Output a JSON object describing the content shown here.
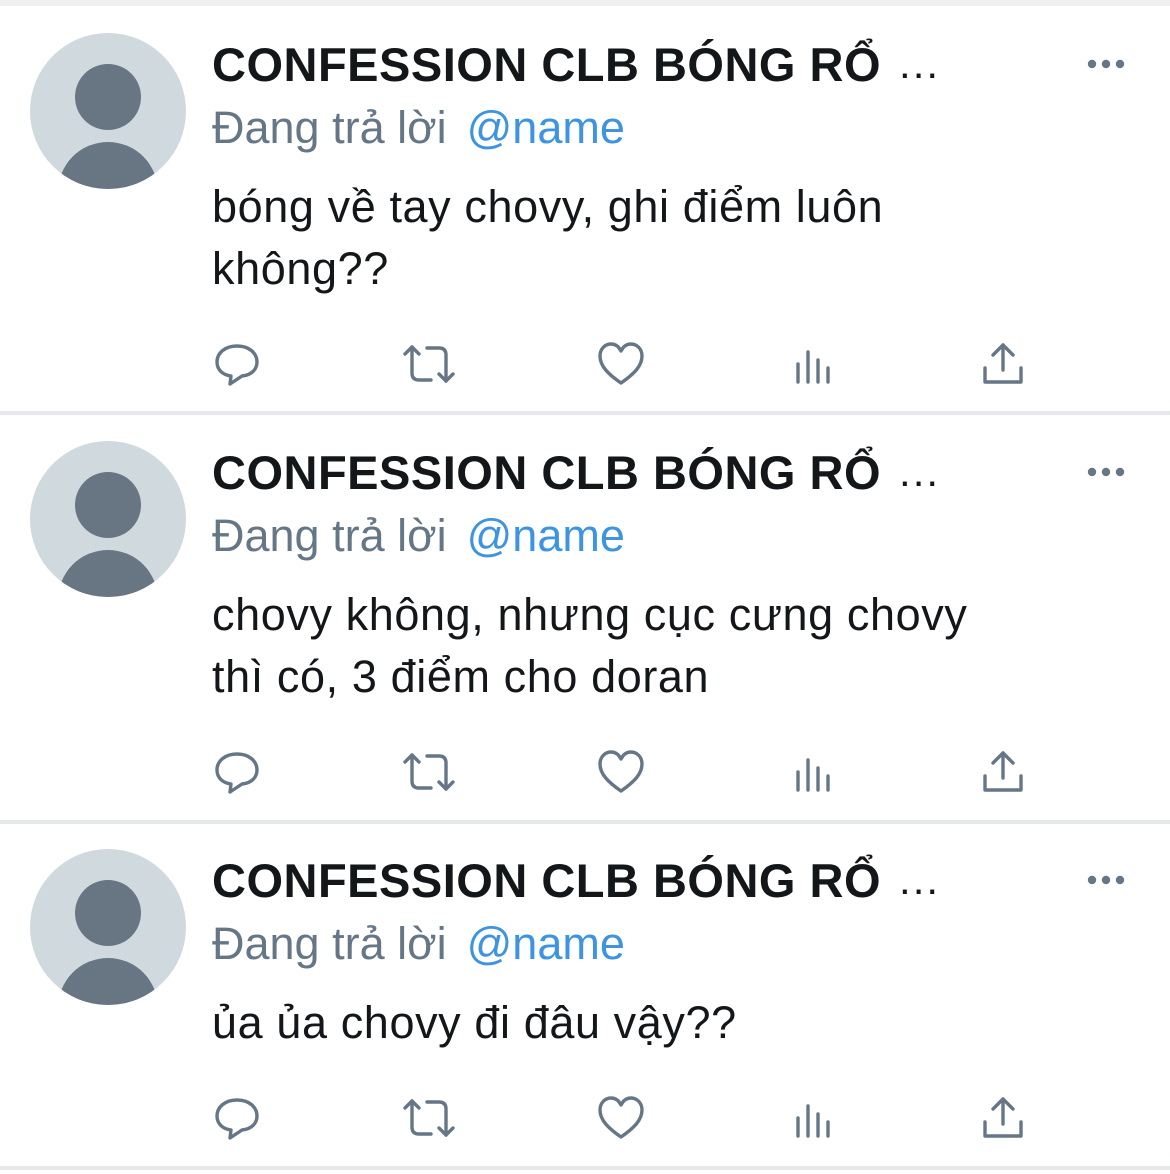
{
  "colors": {
    "name": "#14171a",
    "secondary": "#657786",
    "link": "#3d94e0",
    "icon": "#657786",
    "avatar_bg": "#cfd9de",
    "avatar_fg": "#687684",
    "divider": "#e6e9ec"
  },
  "icons": {
    "more": "more-horizontal-icon",
    "reply": "reply-icon",
    "retweet": "retweet-icon",
    "like": "heart-icon",
    "analytics": "analytics-icon",
    "share": "share-icon",
    "avatar": "default-avatar-icon"
  },
  "tweets": [
    {
      "display_name": "CONFESSION CLB BÓNG RỔ",
      "name_ellipsis": "...",
      "reply_prefix": "Đang trả lời",
      "reply_handle": "@name",
      "text_lines": [
        "bóng về tay chovy, ghi điểm luôn",
        "không??"
      ]
    },
    {
      "display_name": "CONFESSION CLB BÓNG RỔ",
      "name_ellipsis": "...",
      "reply_prefix": "Đang trả lời",
      "reply_handle": "@name",
      "text_lines": [
        "chovy không, nhưng cục cưng chovy",
        "thì có, 3 điểm cho doran"
      ]
    },
    {
      "display_name": "CONFESSION CLB BÓNG RỔ",
      "name_ellipsis": "...",
      "reply_prefix": "Đang trả lời",
      "reply_handle": "@name",
      "text_lines": [
        "ủa ủa chovy đi đâu vậy??"
      ]
    }
  ]
}
